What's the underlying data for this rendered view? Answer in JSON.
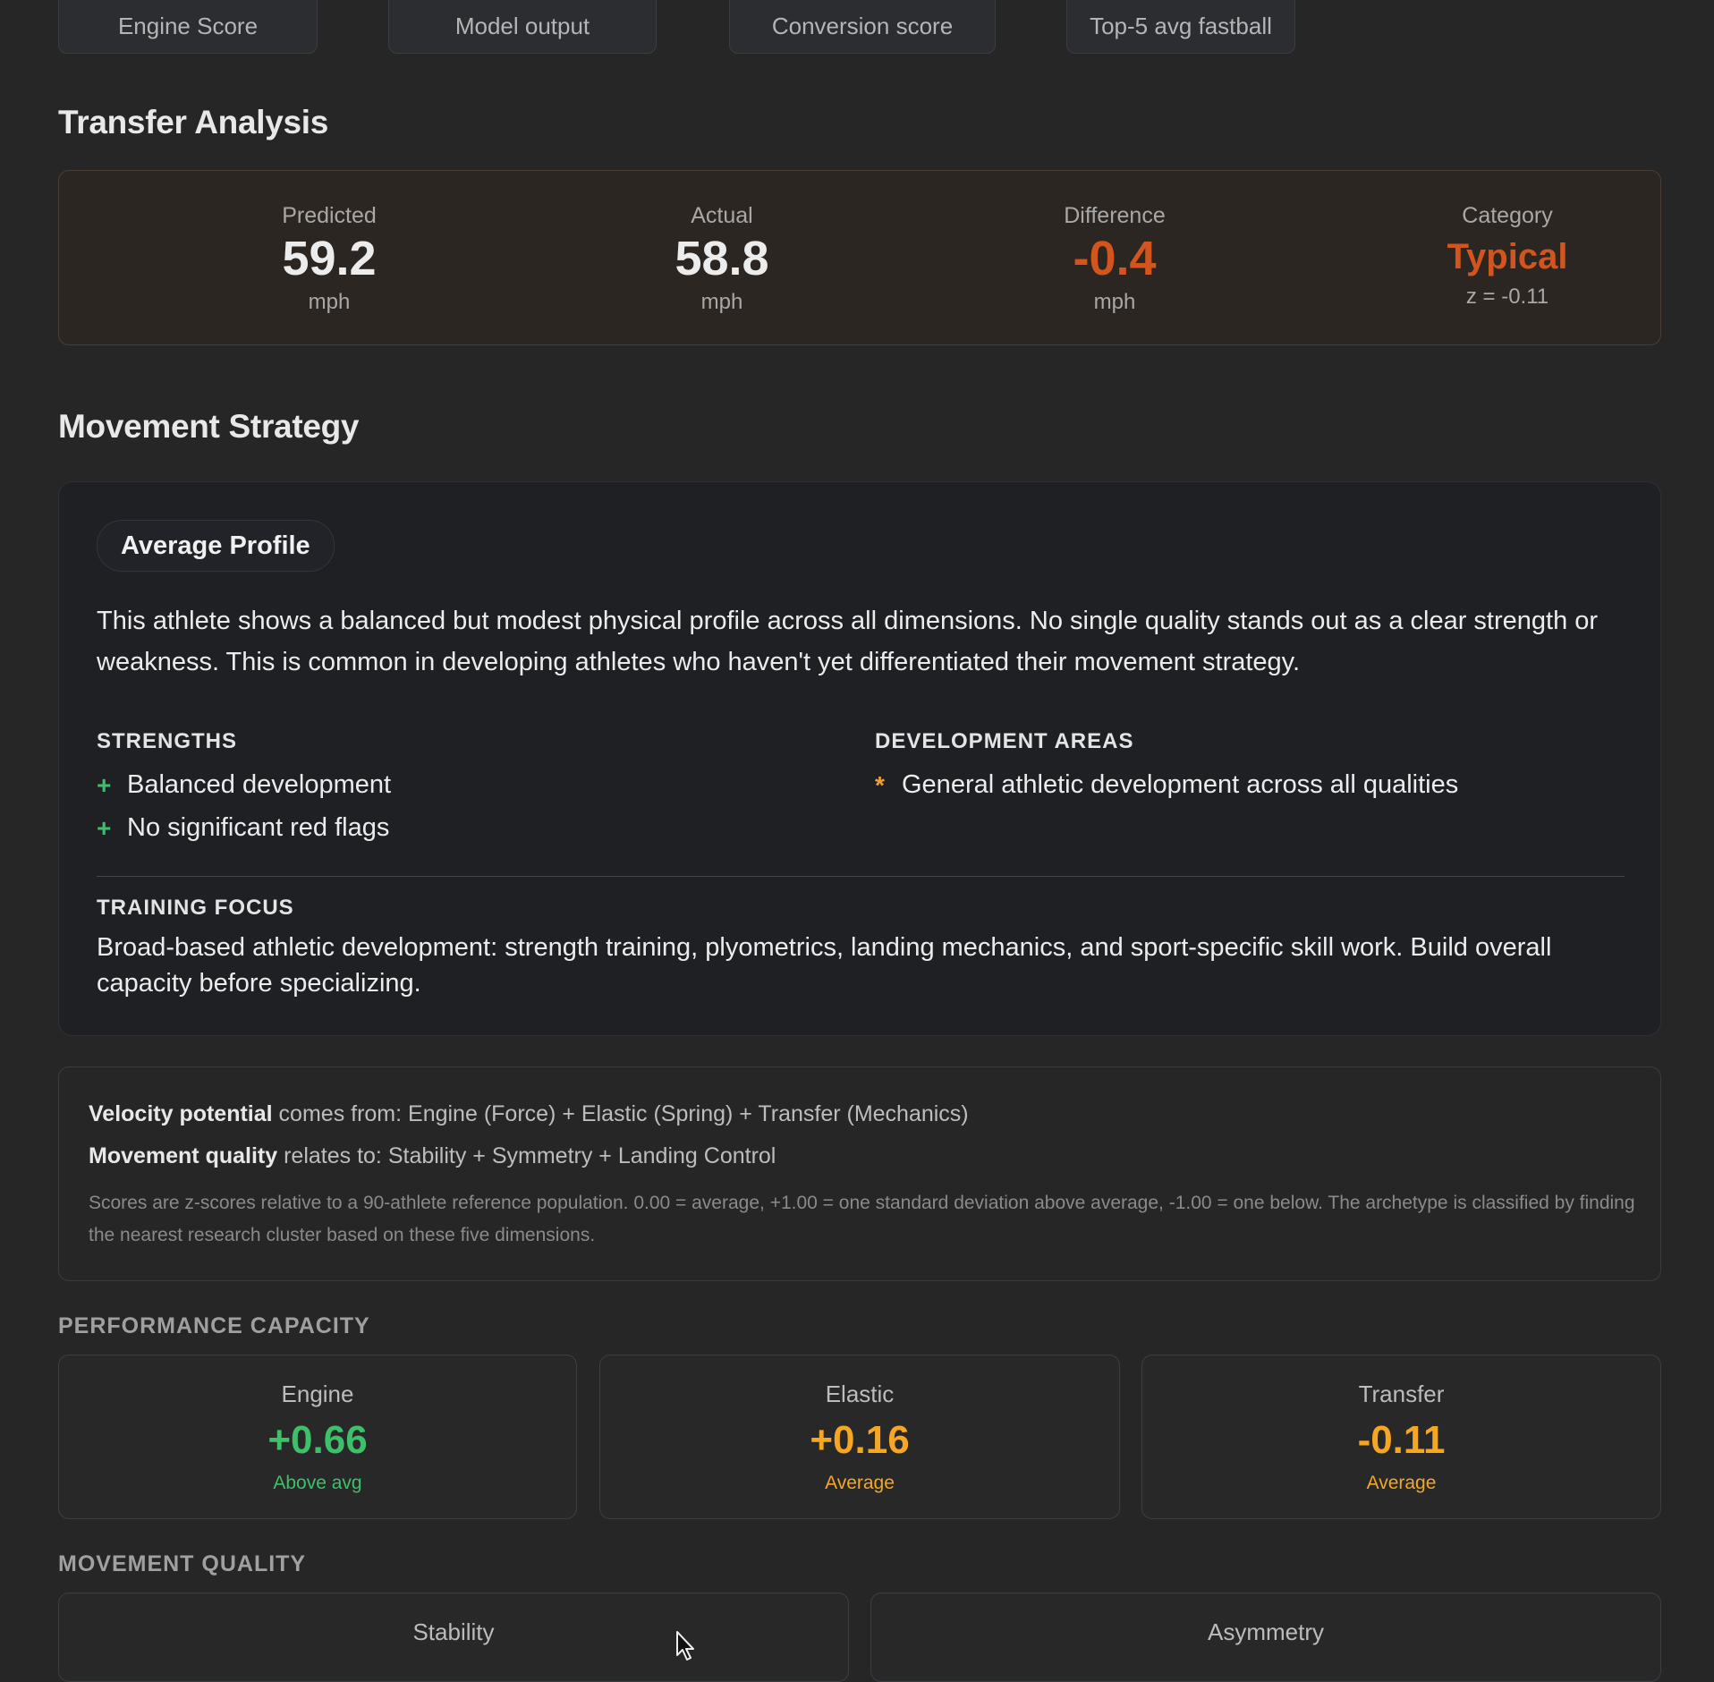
{
  "top_cards": [
    {
      "label": "Engine Score"
    },
    {
      "label": "Model output"
    },
    {
      "label": "Conversion score"
    },
    {
      "label": "Top-5 avg fastball"
    }
  ],
  "transfer": {
    "title": "Transfer Analysis",
    "predicted": {
      "label": "Predicted",
      "value": "59.2",
      "unit": "mph"
    },
    "actual": {
      "label": "Actual",
      "value": "58.8",
      "unit": "mph"
    },
    "difference": {
      "label": "Difference",
      "value": "-0.4",
      "unit": "mph"
    },
    "category": {
      "label": "Category",
      "value": "Typical",
      "z": "z = -0.11"
    }
  },
  "strategy": {
    "title": "Movement Strategy",
    "badge": "Average Profile",
    "description": "This athlete shows a balanced but modest physical profile across all dimensions. No single quality stands out as a clear strength or weakness. This is common in developing athletes who haven't yet differentiated their movement strategy.",
    "strengths_title": "STRENGTHS",
    "strengths": [
      "Balanced development",
      "No significant red flags"
    ],
    "dev_title": "DEVELOPMENT AREAS",
    "dev_areas": [
      "General athletic development across all qualities"
    ],
    "focus_title": "TRAINING FOCUS",
    "focus_text": "Broad-based athletic development: strength training, plyometrics, landing mechanics, and sport-specific skill work. Build overall capacity before specializing."
  },
  "explain": {
    "line1_bold": "Velocity potential",
    "line1_rest": " comes from: Engine (Force) + Elastic (Spring) + Transfer (Mechanics)",
    "line2_bold": "Movement quality",
    "line2_rest": " relates to: Stability + Symmetry + Landing Control",
    "note": "Scores are z-scores relative to a 90-athlete reference population. 0.00 = average, +1.00 = one standard deviation above average, -1.00 = one below. The archetype is classified by finding the nearest research cluster based on these five dimensions."
  },
  "performance": {
    "title": "PERFORMANCE CAPACITY",
    "cards": [
      {
        "label": "Engine",
        "value": "+0.66",
        "sub": "Above avg",
        "color": "#3ec06a"
      },
      {
        "label": "Elastic",
        "value": "+0.16",
        "sub": "Average",
        "color": "#f5a623"
      },
      {
        "label": "Transfer",
        "value": "-0.11",
        "sub": "Average",
        "color": "#f5a623"
      }
    ]
  },
  "movement": {
    "title": "MOVEMENT QUALITY",
    "cards": [
      {
        "label": "Stability"
      },
      {
        "label": "Asymmetry"
      }
    ]
  },
  "colors": {
    "negative": "#d2551e",
    "positive": "#3ec06a",
    "average": "#f5a623"
  }
}
